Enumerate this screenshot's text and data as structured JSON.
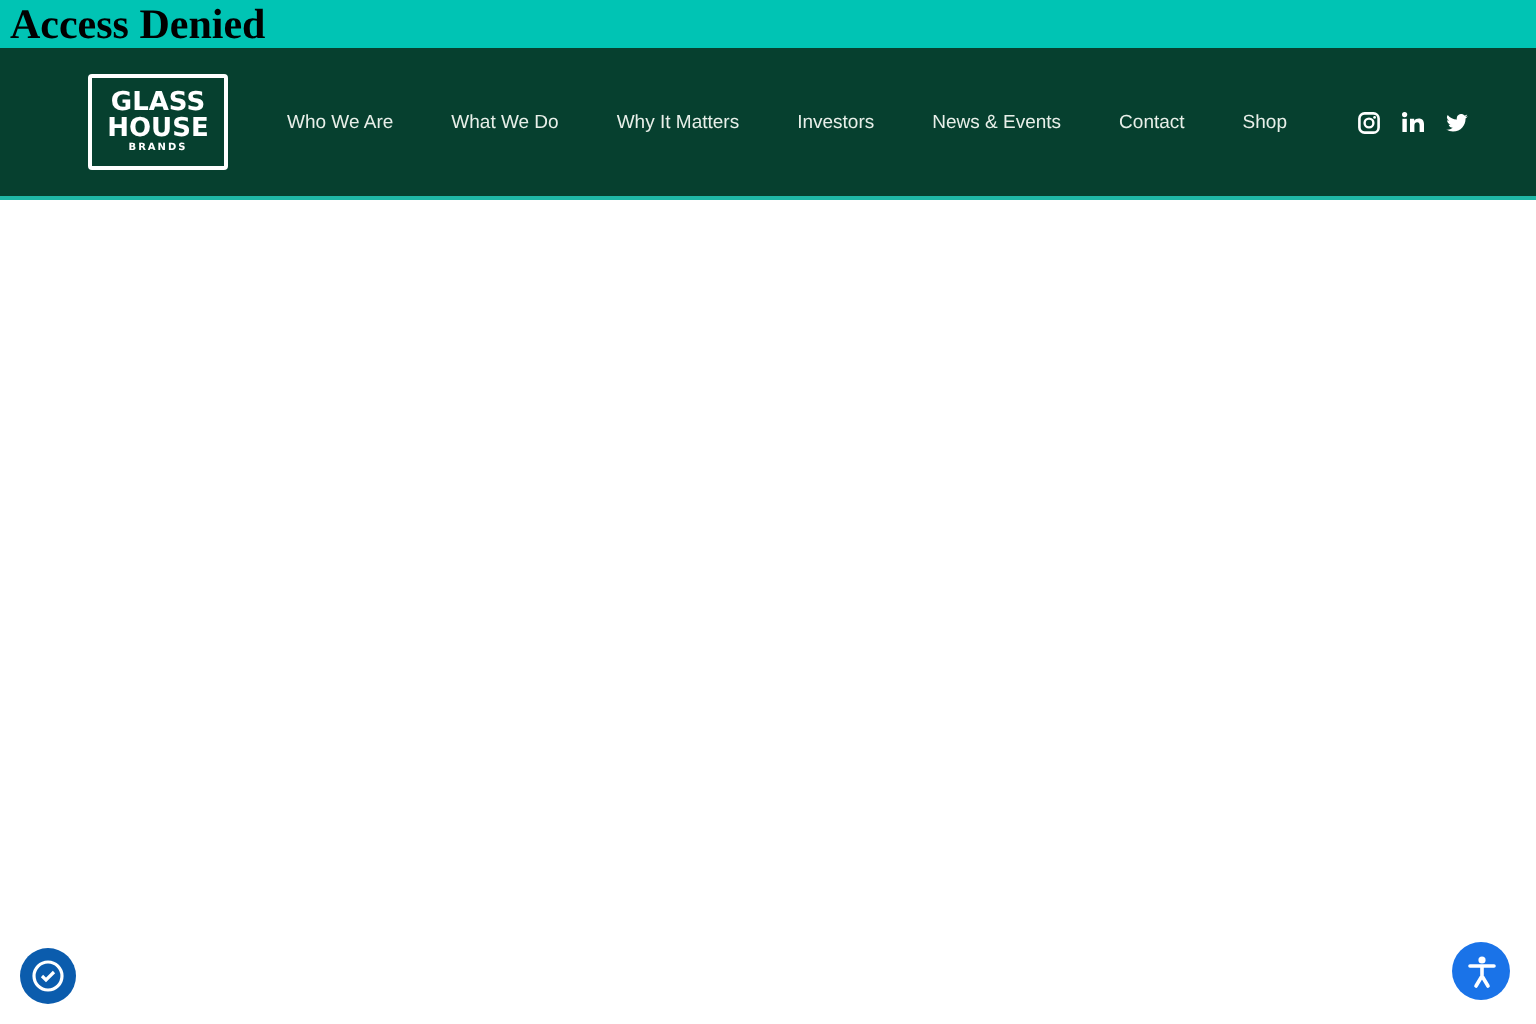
{
  "heading": "Access Denied",
  "logo": {
    "lines": [
      "GLASS",
      "HOUSE"
    ],
    "tagline": "BRANDS"
  },
  "nav": {
    "items": [
      "Who We Are",
      "What We Do",
      "Why It Matters",
      "Investors",
      "News & Events",
      "Contact",
      "Shop"
    ]
  },
  "social": [
    {
      "kind": "instagram"
    },
    {
      "kind": "linkedin"
    },
    {
      "kind": "twitter"
    }
  ]
}
